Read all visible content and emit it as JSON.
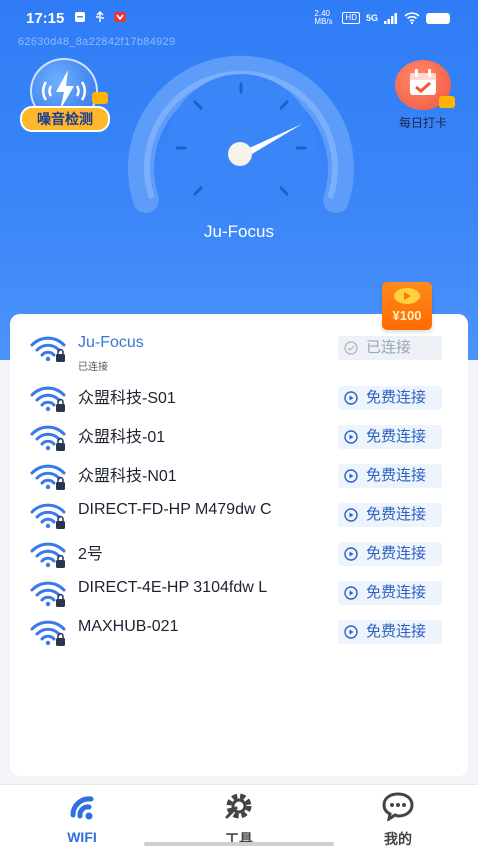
{
  "status_bar": {
    "time": "17:15",
    "net_speed": "2.40 MB/s",
    "hd": "HD",
    "signal": "5G"
  },
  "device_id": "62630d48_8a22842f17b84929",
  "header": {
    "noise_test_label": "噪音检测",
    "checkin_label": "每日打卡",
    "current_ssid": "Ju-Focus"
  },
  "reward": {
    "amount": "¥100"
  },
  "networks": [
    {
      "name": "Ju-Focus",
      "sub": "已连接",
      "action": "已连接",
      "connected": true
    },
    {
      "name": "众盟科技-S01",
      "action": "免费连接",
      "connected": false
    },
    {
      "name": "众盟科技-01",
      "action": "免费连接",
      "connected": false
    },
    {
      "name": "众盟科技-N01",
      "action": "免费连接",
      "connected": false
    },
    {
      "name": "DIRECT-FD-HP M479dw C",
      "action": "免费连接",
      "connected": false
    },
    {
      "name": "2号",
      "action": "免费连接",
      "connected": false
    },
    {
      "name": "DIRECT-4E-HP 3104fdw L",
      "action": "免费连接",
      "connected": false
    },
    {
      "name": "MAXHUB-021",
      "action": "免费连接",
      "connected": false
    }
  ],
  "tabs": [
    {
      "label": "WIFI",
      "active": true
    },
    {
      "label": "工具",
      "active": false
    },
    {
      "label": "我的",
      "active": false
    }
  ],
  "colors": {
    "primary": "#2f7cf6",
    "accent": "#ffb82e",
    "active_tab": "#2f6fe0",
    "inactive_tab": "#444444"
  }
}
